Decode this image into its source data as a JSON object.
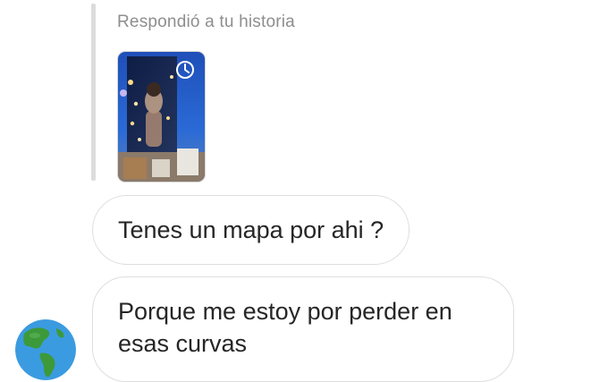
{
  "story_reply": {
    "caption": "Respondió a tu historia",
    "thumbnail_icon": "story-replay-icon"
  },
  "messages": [
    {
      "lines": [
        "Tenes un mapa por ahi ?"
      ]
    },
    {
      "lines": [
        "Porque me estoy por perder en",
        "esas curvas"
      ]
    }
  ],
  "sender": {
    "avatar_icon": "globe-americas-emoji"
  },
  "colors": {
    "caption_gray": "#8e8e8e",
    "bubble_border": "#dedede",
    "reply_bar": "#dcdcdc",
    "text": "#262626",
    "globe_ocean": "#3b9be0",
    "globe_land": "#3c9a3a"
  }
}
